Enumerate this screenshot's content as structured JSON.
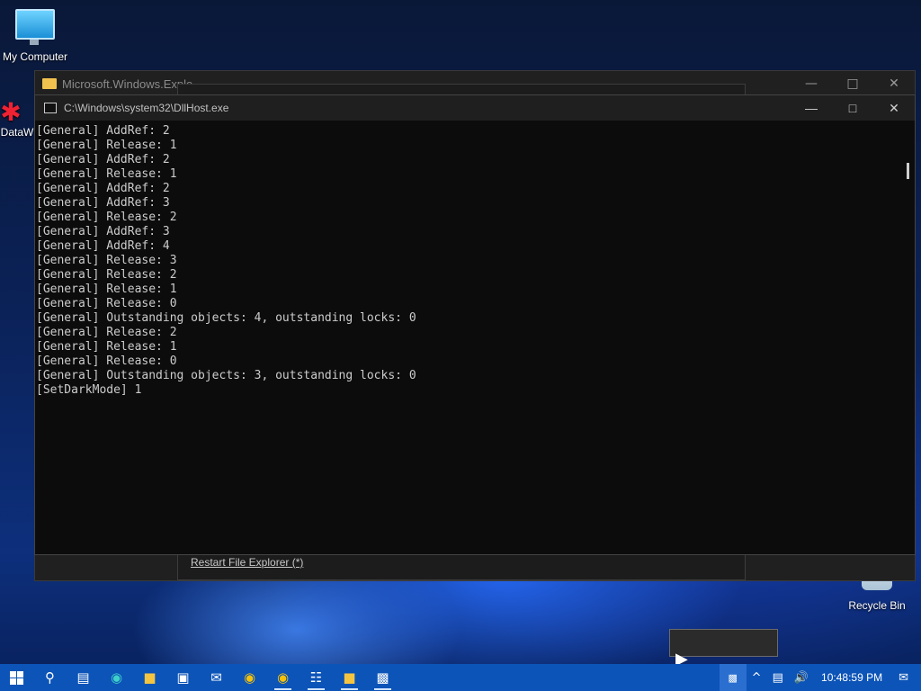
{
  "desktop": {
    "icons": [
      {
        "label": "My Computer"
      },
      {
        "label": "DataW"
      },
      {
        "label": "Recycle Bin"
      }
    ]
  },
  "explorer_window": {
    "title": "Microsoft.Windows.Explo",
    "restart_link": "Restart File Explorer (*)"
  },
  "console_window": {
    "title": "C:\\Windows\\system32\\DllHost.exe",
    "lines": [
      "[General] AddRef: 2",
      "[General] Release: 1",
      "[General] AddRef: 2",
      "[General] Release: 1",
      "[General] AddRef: 2",
      "[General] AddRef: 3",
      "[General] Release: 2",
      "[General] AddRef: 3",
      "[General] AddRef: 4",
      "[General] Release: 3",
      "[General] Release: 2",
      "[General] Release: 1",
      "[General] Release: 0",
      "[General] Outstanding objects: 4, outstanding locks: 0",
      "[General] Release: 2",
      "[General] Release: 1",
      "[General] Release: 0",
      "[General] Outstanding objects: 3, outstanding locks: 0",
      "[SetDarkMode] 1"
    ]
  },
  "taskbar": {
    "clock": "10:48:59 PM",
    "apps": [
      "start-icon",
      "search-icon",
      "task-view-icon",
      "edge-icon",
      "file-explorer-icon",
      "store-icon",
      "mail-icon",
      "chrome-icon",
      "chrome-icon",
      "notepad-icon",
      "file-explorer-icon",
      "console-icon"
    ]
  },
  "colors": {
    "taskbar": "#0c54b8",
    "console_bg": "#0c0c0c",
    "console_text": "#cccccc"
  }
}
